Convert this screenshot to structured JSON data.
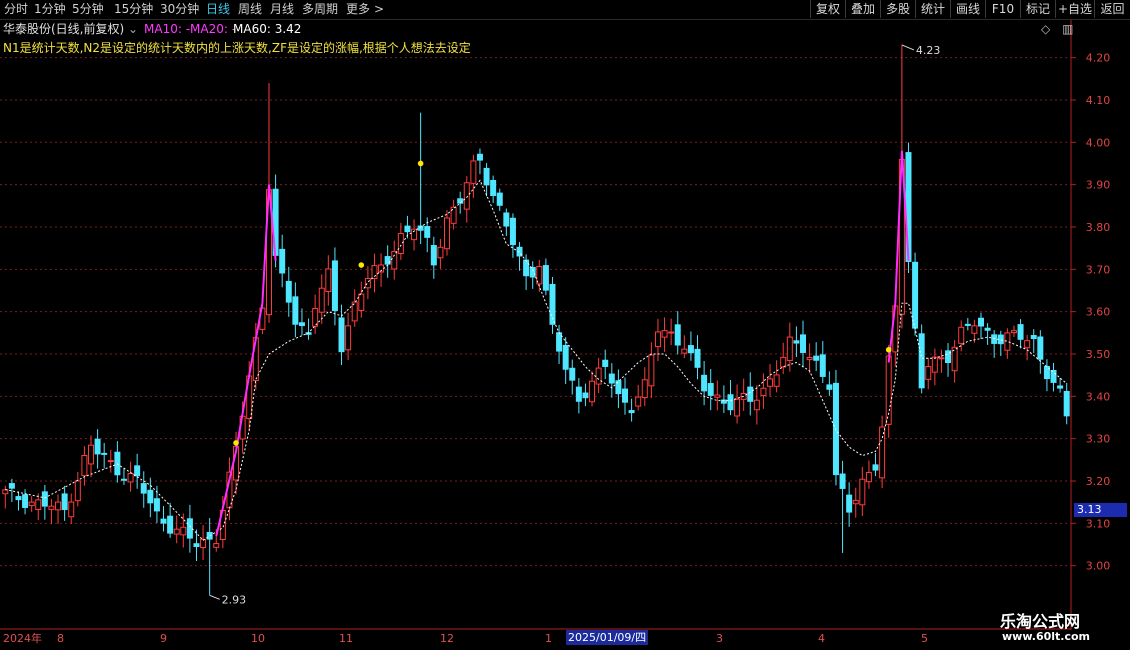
{
  "toolbar": {
    "periods": [
      "分时",
      "1分钟",
      "5分钟",
      "15分钟",
      "30分钟",
      "日线",
      "周线",
      "月线",
      "多周期",
      "更多"
    ],
    "more_arrow": ">",
    "active": "日线",
    "right_buttons": [
      "复权",
      "叠加",
      "多股",
      "统计",
      "画线",
      "F10",
      "标记",
      "+自选",
      "返回"
    ]
  },
  "info": {
    "title": "华泰股份(日线,前复权)",
    "ma10": "MA10: -",
    "ma20": "MA20: -",
    "ma60": "MA60: 3.42"
  },
  "note": "N1是统计天数,N2是设定的统计天数内的上涨天数,ZF是设定的涨幅,根据个人想法去设定",
  "price_axis": {
    "ticks": [
      "4.20",
      "4.10",
      "4.00",
      "3.90",
      "3.80",
      "3.70",
      "3.60",
      "3.50",
      "3.40",
      "3.30",
      "3.20",
      "3.10",
      "3.00"
    ],
    "current_price": "3.13"
  },
  "annotations": {
    "high": "4.23",
    "low": "2.93"
  },
  "date_axis": {
    "labels": [
      "2024年",
      "8",
      "9",
      "10",
      "11",
      "12",
      "1",
      "2025/01/09/四",
      "3",
      "4",
      "5"
    ],
    "highlight": "2025/01/09/四"
  },
  "watermark": {
    "line1": "乐淘公式网",
    "line2": "www.60lt.com"
  },
  "colors": {
    "up": "#ff3c3c",
    "down": "#4fe6ff",
    "ma": "#ffffff",
    "signal": "#ff2cff",
    "dot": "#ffe600",
    "grid": "#7a1e1e",
    "axis": "#b02020"
  },
  "chart_data": {
    "type": "candlestick",
    "ylim": [
      2.9,
      4.27
    ],
    "close_path": [
      [
        0,
        3.17
      ],
      [
        9,
        3.13
      ],
      [
        12,
        3.25
      ],
      [
        13,
        3.28
      ],
      [
        16,
        3.24
      ],
      [
        20,
        3.2
      ],
      [
        23,
        3.12
      ],
      [
        29,
        3.05
      ],
      [
        32,
        3.07
      ],
      [
        35,
        3.27
      ],
      [
        37,
        3.45
      ],
      [
        39,
        3.62
      ],
      [
        40,
        3.9
      ],
      [
        41,
        3.72
      ],
      [
        44,
        3.58
      ],
      [
        46,
        3.55
      ],
      [
        47,
        3.62
      ],
      [
        49,
        3.68
      ],
      [
        51,
        3.52
      ],
      [
        53,
        3.62
      ],
      [
        55,
        3.68
      ],
      [
        57,
        3.7
      ],
      [
        60,
        3.78
      ],
      [
        62,
        3.8
      ],
      [
        64,
        3.76
      ],
      [
        65,
        3.72
      ],
      [
        67,
        3.82
      ],
      [
        69,
        3.86
      ],
      [
        71,
        3.94
      ],
      [
        72,
        3.96
      ],
      [
        74,
        3.88
      ],
      [
        76,
        3.8
      ],
      [
        79,
        3.68
      ],
      [
        81,
        3.72
      ],
      [
        83,
        3.56
      ],
      [
        85,
        3.46
      ],
      [
        87,
        3.4
      ],
      [
        89,
        3.43
      ],
      [
        91,
        3.47
      ],
      [
        93,
        3.4
      ],
      [
        95,
        3.38
      ],
      [
        97,
        3.42
      ],
      [
        99,
        3.56
      ],
      [
        101,
        3.55
      ],
      [
        103,
        3.52
      ],
      [
        106,
        3.42
      ],
      [
        108,
        3.4
      ],
      [
        110,
        3.38
      ],
      [
        113,
        3.39
      ],
      [
        115,
        3.42
      ],
      [
        117,
        3.46
      ],
      [
        119,
        3.52
      ],
      [
        121,
        3.52
      ],
      [
        123,
        3.48
      ],
      [
        125,
        3.42
      ],
      [
        126,
        3.2
      ],
      [
        128,
        3.14
      ],
      [
        130,
        3.2
      ],
      [
        132,
        3.23
      ],
      [
        133,
        3.32
      ],
      [
        134,
        3.48
      ],
      [
        135,
        3.62
      ],
      [
        136,
        3.98
      ],
      [
        137,
        3.72
      ],
      [
        138,
        3.55
      ],
      [
        139,
        3.42
      ],
      [
        140,
        3.47
      ],
      [
        143,
        3.5
      ],
      [
        145,
        3.55
      ],
      [
        147,
        3.57
      ],
      [
        150,
        3.54
      ],
      [
        153,
        3.54
      ],
      [
        156,
        3.53
      ],
      [
        158,
        3.46
      ],
      [
        160,
        3.4
      ],
      [
        161,
        3.35
      ]
    ],
    "n_bars": 162,
    "ma60_path": [
      [
        0,
        3.18
      ],
      [
        6,
        3.16
      ],
      [
        12,
        3.21
      ],
      [
        17,
        3.24
      ],
      [
        22,
        3.19
      ],
      [
        27,
        3.11
      ],
      [
        30,
        3.06
      ],
      [
        33,
        3.09
      ],
      [
        35,
        3.18
      ],
      [
        37,
        3.32
      ],
      [
        38,
        3.44
      ],
      [
        40,
        3.5
      ],
      [
        43,
        3.53
      ],
      [
        46,
        3.55
      ],
      [
        49,
        3.6
      ],
      [
        51,
        3.59
      ],
      [
        53,
        3.62
      ],
      [
        55,
        3.67
      ],
      [
        58,
        3.71
      ],
      [
        61,
        3.78
      ],
      [
        64,
        3.81
      ],
      [
        67,
        3.83
      ],
      [
        70,
        3.87
      ],
      [
        72,
        3.91
      ],
      [
        74,
        3.84
      ],
      [
        76,
        3.76
      ],
      [
        78,
        3.74
      ],
      [
        80,
        3.7
      ],
      [
        82,
        3.62
      ],
      [
        84,
        3.55
      ],
      [
        86,
        3.51
      ],
      [
        88,
        3.47
      ],
      [
        90,
        3.44
      ],
      [
        92,
        3.42
      ],
      [
        94,
        3.45
      ],
      [
        96,
        3.48
      ],
      [
        98,
        3.5
      ],
      [
        100,
        3.5
      ],
      [
        102,
        3.47
      ],
      [
        104,
        3.43
      ],
      [
        106,
        3.4
      ],
      [
        108,
        3.39
      ],
      [
        110,
        3.39
      ],
      [
        112,
        3.4
      ],
      [
        114,
        3.42
      ],
      [
        116,
        3.45
      ],
      [
        118,
        3.47
      ],
      [
        120,
        3.48
      ],
      [
        122,
        3.46
      ],
      [
        124,
        3.39
      ],
      [
        126,
        3.32
      ],
      [
        128,
        3.28
      ],
      [
        130,
        3.26
      ],
      [
        132,
        3.27
      ],
      [
        133,
        3.3
      ],
      [
        134,
        3.36
      ],
      [
        135,
        3.44
      ],
      [
        136,
        3.62
      ],
      [
        137,
        3.62
      ],
      [
        138,
        3.56
      ],
      [
        139,
        3.49
      ],
      [
        141,
        3.49
      ],
      [
        143,
        3.5
      ],
      [
        146,
        3.53
      ],
      [
        149,
        3.54
      ],
      [
        152,
        3.53
      ],
      [
        155,
        3.51
      ],
      [
        158,
        3.47
      ],
      [
        161,
        3.43
      ]
    ],
    "signal_segments": [
      [
        32,
        41
      ],
      [
        134,
        137
      ]
    ],
    "dots": [
      [
        35,
        3.29
      ],
      [
        54,
        3.71
      ],
      [
        63,
        3.95
      ],
      [
        134,
        3.51
      ]
    ],
    "spikes": [
      [
        40,
        4.14
      ],
      [
        63,
        4.07
      ],
      [
        136,
        4.23
      ],
      [
        31,
        2.93
      ],
      [
        127,
        3.03
      ]
    ]
  }
}
